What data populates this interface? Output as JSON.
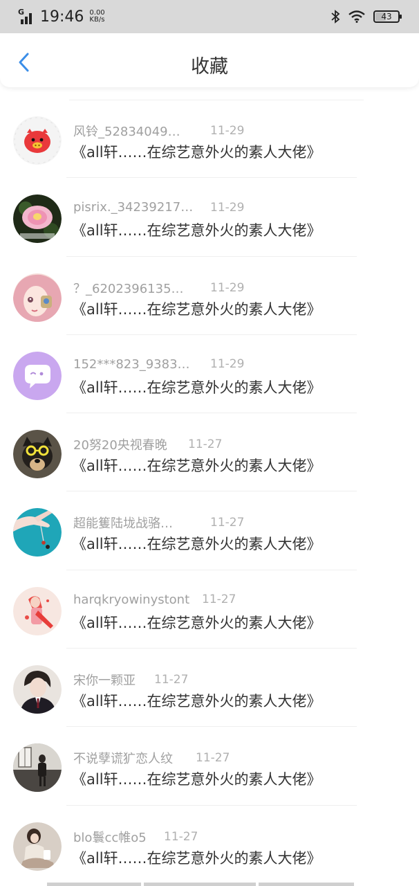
{
  "status_bar": {
    "network": "G",
    "time": "19:46",
    "speed_value": "0.00",
    "speed_unit": "KB/s",
    "battery": "43",
    "battery_level": 0.43
  },
  "header": {
    "title": "收藏",
    "accent_color": "#3b8ee8"
  },
  "items": [
    {
      "user": "风铃_52834049…",
      "date": "11-29",
      "title": "《all轩……在综艺意外火的素人大佬》",
      "avatar": "pig-avatar"
    },
    {
      "user": "pisrix._34239217…",
      "date": "11-29",
      "title": "《all轩……在综艺意外火的素人大佬》",
      "avatar": "flower-avatar"
    },
    {
      "user": "？_6202396135…",
      "date": "11-29",
      "title": "《all轩……在综艺意外火的素人大佬》",
      "avatar": "girl-avatar"
    },
    {
      "user": "152***823_9383…",
      "date": "11-29",
      "title": "《all轩……在综艺意外火的素人大佬》",
      "avatar": "chat-bubble-avatar"
    },
    {
      "user": "20努20央视春晚",
      "date": "11-27",
      "title": "《all轩……在综艺意外火的素人大佬》",
      "avatar": "dog-avatar"
    },
    {
      "user": "超能篗陆垅战骆…",
      "date": "11-27",
      "title": "《all轩……在综艺意外火的素人大佬》",
      "avatar": "hand-avatar"
    },
    {
      "user": "harqkryowinystont",
      "date": "11-27",
      "title": "《all轩……在综艺意外火的素人大佬》",
      "avatar": "illustration-avatar"
    },
    {
      "user": "宋你一颗亚",
      "date": "11-27",
      "title": "《all轩……在综艺意外火的素人大佬》",
      "avatar": "boy-avatar"
    },
    {
      "user": "不说孽谎犷恋人纹",
      "date": "11-27",
      "title": "《all轩……在综艺意外火的素人大佬》",
      "avatar": "room-avatar"
    },
    {
      "user": "blo鬟cc帷o5",
      "date": "11-27",
      "title": "《all轩……在综艺意外火的素人大佬》",
      "avatar": "sitting-girl-avatar"
    }
  ]
}
